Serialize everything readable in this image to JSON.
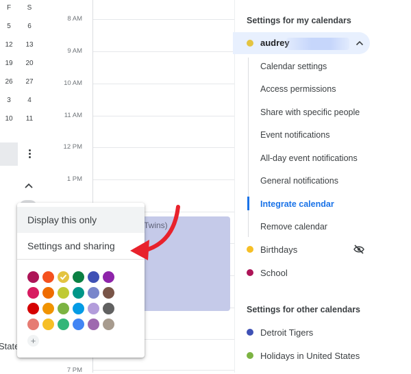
{
  "mini_calendar": {
    "headers": [
      "F",
      "S"
    ],
    "rows": [
      [
        "5",
        "6"
      ],
      [
        "12",
        "13"
      ],
      [
        "19",
        "20"
      ],
      [
        "26",
        "27"
      ],
      [
        "3",
        "4"
      ],
      [
        "10",
        "11"
      ]
    ]
  },
  "time_grid": {
    "hours": [
      "8 AM",
      "9 AM",
      "10 AM",
      "11 AM",
      "12 PM",
      "1 PM",
      "",
      "",
      "",
      "",
      "7 PM"
    ],
    "event": {
      "title": "Twins)",
      "color": "#c5cae9"
    }
  },
  "left_fragment": "State",
  "popup": {
    "items": [
      "Display this only",
      "Settings and sharing"
    ],
    "colors": [
      "#ad1457",
      "#f4511e",
      "#e4c441",
      "#0b8043",
      "#3f51b5",
      "#8e24aa",
      "#d81b60",
      "#ef6c00",
      "#c0ca33",
      "#009688",
      "#7986cb",
      "#795548",
      "#d50000",
      "#f09300",
      "#7cb342",
      "#039be5",
      "#b39ddb",
      "#616161",
      "#e67c73",
      "#f6bf26",
      "#33b679",
      "#4285f4",
      "#9e69af",
      "#a79b8e"
    ],
    "selected_color_index": 2,
    "add_color": "+"
  },
  "settings": {
    "my_calendars_title": "Settings for my calendars",
    "active_calendar": {
      "name": "audrey",
      "color": "#e4c441"
    },
    "sub_items": [
      "Calendar settings",
      "Access permissions",
      "Share with specific people",
      "Event notifications",
      "All-day event notifications",
      "General notifications",
      "Integrate calendar",
      "Remove calendar"
    ],
    "active_sub_item_index": 6,
    "other_my_calendars": [
      {
        "name": "Birthdays",
        "color": "#f6bf26",
        "hidden": true
      },
      {
        "name": "School",
        "color": "#ad1457",
        "hidden": false
      }
    ],
    "other_calendars_title": "Settings for other calendars",
    "other_calendars": [
      {
        "name": "Detroit Tigers",
        "color": "#3f51b5"
      },
      {
        "name": "Holidays in United States",
        "color": "#7cb342"
      }
    ],
    "accent_color": "#1a73e8"
  }
}
